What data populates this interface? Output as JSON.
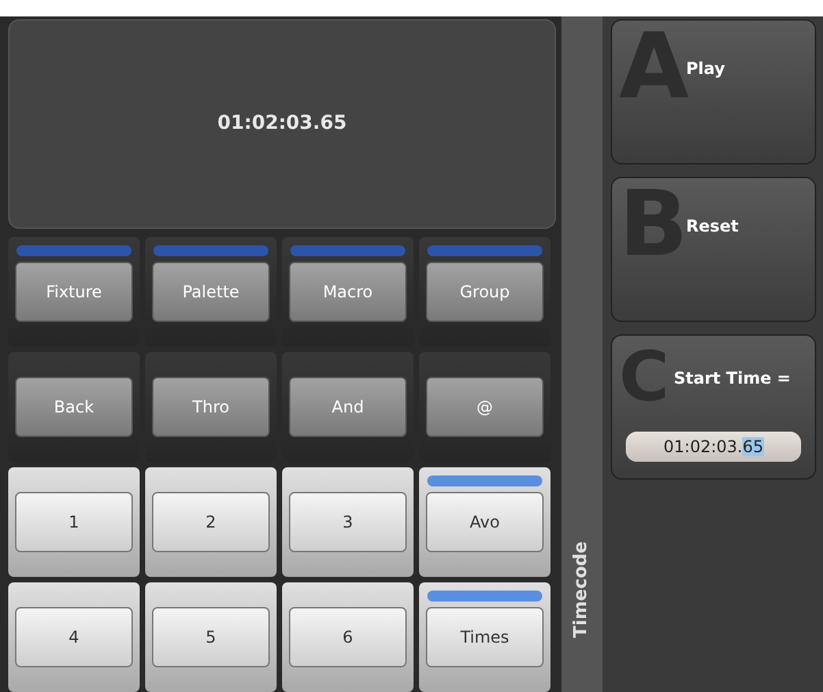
{
  "display": {
    "time": "01:02:03.65"
  },
  "keys": [
    {
      "label": "Fixture",
      "kind": "dark",
      "indicator": true
    },
    {
      "label": "Palette",
      "kind": "dark",
      "indicator": true
    },
    {
      "label": "Macro",
      "kind": "dark",
      "indicator": true
    },
    {
      "label": "Group",
      "kind": "dark",
      "indicator": true
    },
    {
      "label": "Back",
      "kind": "dark",
      "indicator": false
    },
    {
      "label": "Thro",
      "kind": "dark",
      "indicator": false
    },
    {
      "label": "And",
      "kind": "dark",
      "indicator": false
    },
    {
      "label": "@",
      "kind": "dark",
      "indicator": false
    },
    {
      "label": "1",
      "kind": "light",
      "indicator": false
    },
    {
      "label": "2",
      "kind": "light",
      "indicator": false
    },
    {
      "label": "3",
      "kind": "light",
      "indicator": false
    },
    {
      "label": "Avo",
      "kind": "light",
      "indicator": true
    },
    {
      "label": "4",
      "kind": "light",
      "indicator": false
    },
    {
      "label": "5",
      "kind": "light",
      "indicator": false
    },
    {
      "label": "6",
      "kind": "light",
      "indicator": false
    },
    {
      "label": "Times",
      "kind": "light",
      "indicator": true
    }
  ],
  "side_tab": {
    "label": "Timecode"
  },
  "soft_keys": [
    {
      "letter": "A",
      "kind": "button",
      "label": "Play"
    },
    {
      "letter": "B",
      "kind": "button",
      "label": "Reset"
    },
    {
      "letter": "C",
      "kind": "input",
      "label": "Start Time =",
      "field": [
        {
          "text": "01:02:03.",
          "selected": false
        },
        {
          "text": "65",
          "selected": true
        }
      ]
    }
  ]
}
